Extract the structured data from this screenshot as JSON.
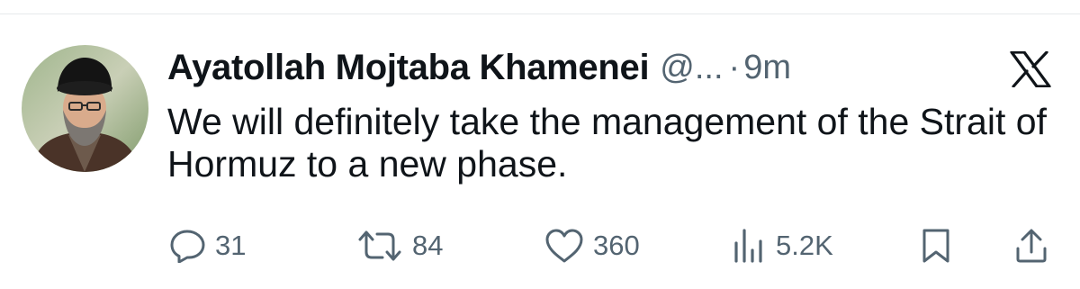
{
  "tweet": {
    "author_name": "Ayatollah Mojtaba Khamenei",
    "handle": "@...",
    "separator": "·",
    "time": "9m",
    "text": "We will definitely take the management of the Strait of Hormuz to a new phase."
  },
  "actions": {
    "replies": "31",
    "reposts": "84",
    "likes": "360",
    "views": "5.2K"
  },
  "icons": {
    "avatar": "profile-photo",
    "logo": "x-logo-icon",
    "reply": "reply-icon",
    "repost": "repost-icon",
    "like": "heart-icon",
    "views": "views-icon",
    "bookmark": "bookmark-icon",
    "share": "share-icon"
  },
  "colors": {
    "text": "#0f1419",
    "secondary": "#536471",
    "divider": "#e6e9eb",
    "background": "#ffffff"
  }
}
